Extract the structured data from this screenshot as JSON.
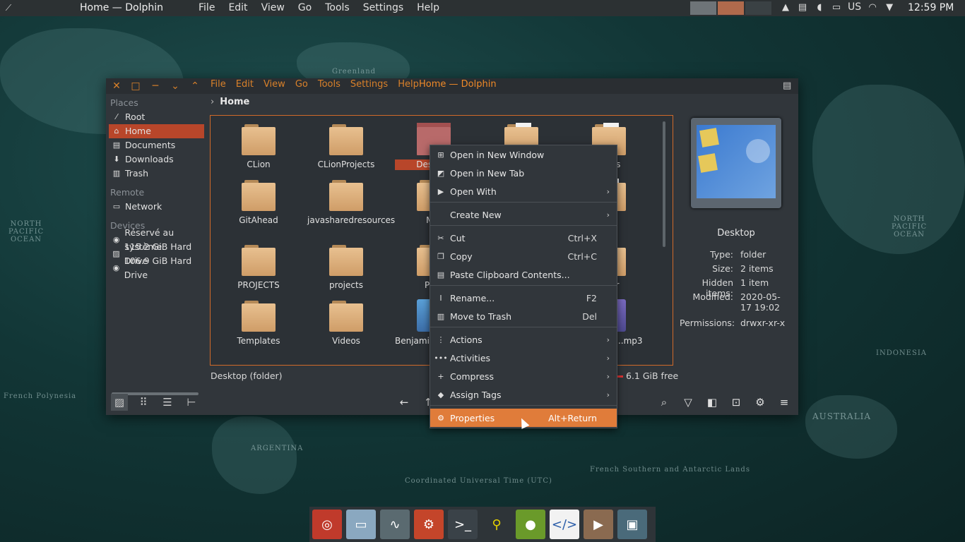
{
  "top_panel": {
    "window_title": "Home — Dolphin",
    "menu": [
      "File",
      "Edit",
      "View",
      "Go",
      "Tools",
      "Settings",
      "Help"
    ],
    "keyboard_layout": "US",
    "clock": "12:59 PM"
  },
  "window": {
    "menu": [
      "File",
      "Edit",
      "View",
      "Go",
      "Tools",
      "Settings",
      "Help"
    ],
    "title": "Home — Dolphin"
  },
  "places": {
    "places_header": "Places",
    "places_items": [
      "Root",
      "Home",
      "Documents",
      "Downloads",
      "Trash"
    ],
    "remote_header": "Remote",
    "remote_items": [
      "Network"
    ],
    "devices_header": "Devices",
    "devices_items": [
      "Réservé au système",
      "115.2 GiB Hard Drive",
      "106.9 GiB Hard Drive"
    ],
    "selected": "Home"
  },
  "breadcrumb": "Home",
  "files": [
    {
      "name": "CLion"
    },
    {
      "name": "CLionProjects"
    },
    {
      "name": "Desktop"
    },
    {
      "name": ""
    },
    {
      "name": "...ads"
    },
    {
      "name": "GitAhead"
    },
    {
      "name": "javasharedresources"
    },
    {
      "name": "M..."
    },
    {
      "name": "...es"
    },
    {
      "name": "PROJECTS"
    },
    {
      "name": "projects"
    },
    {
      "name": "Pu..."
    },
    {
      "name": "...Dir"
    },
    {
      "name": "Templates"
    },
    {
      "name": "Videos"
    },
    {
      "name": "Benjami..._Welco..."
    },
    {
      "name": "...Salda - ...mp3"
    }
  ],
  "status": {
    "left": "Desktop (folder)",
    "right": "6.1 GiB free"
  },
  "preview": {
    "name": "Desktop",
    "type_label": "Type:",
    "type": "folder",
    "size_label": "Size:",
    "size": "2 items",
    "hidden_label": "Hidden items:",
    "hidden": "1 item",
    "modified_label": "Modified:",
    "modified": "2020-05-17 19:02",
    "perm_label": "Permissions:",
    "perm": "drwxr-xr-x"
  },
  "context_menu": {
    "items": [
      {
        "label": "Open in New Window",
        "icon": "new-window-icon"
      },
      {
        "label": "Open in New Tab",
        "icon": "new-tab-icon"
      },
      {
        "label": "Open With",
        "icon": "open-with-icon",
        "submenu": true
      },
      {
        "label": "Create New",
        "icon": "create-new-icon",
        "submenu": true
      },
      {
        "label": "Cut",
        "icon": "cut-icon",
        "shortcut": "Ctrl+X"
      },
      {
        "label": "Copy",
        "icon": "copy-icon",
        "shortcut": "Ctrl+C"
      },
      {
        "label": "Paste Clipboard Contents...",
        "icon": "paste-icon"
      },
      {
        "label": "Rename...",
        "icon": "rename-icon",
        "shortcut": "F2"
      },
      {
        "label": "Move to Trash",
        "icon": "trash-icon",
        "shortcut": "Del"
      },
      {
        "label": "Actions",
        "icon": "actions-icon",
        "submenu": true
      },
      {
        "label": "Activities",
        "icon": "activities-icon",
        "submenu": true
      },
      {
        "label": "Compress",
        "icon": "compress-icon",
        "submenu": true
      },
      {
        "label": "Assign Tags",
        "icon": "tag-icon",
        "submenu": true
      },
      {
        "label": "Properties",
        "icon": "properties-icon",
        "shortcut": "Alt+Return",
        "highlighted": true
      }
    ]
  },
  "map_labels": [
    "Greenland",
    "NORTH PACIFIC OCEAN",
    "NORTH PACIFIC OCEAN",
    "AUSTRALIA",
    "ARGENTINA",
    "INDONESIA",
    "French Polynesia",
    "Coordinated Universal Time (UTC)",
    "French Southern and Antarctic Lands"
  ],
  "colors": {
    "accent": "#e07c3a",
    "selection": "#b8462a",
    "menu_text": "#d9812a"
  }
}
